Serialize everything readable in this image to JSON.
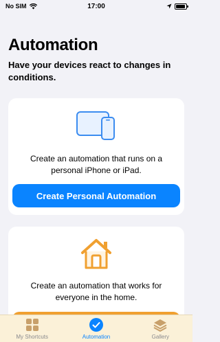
{
  "status": {
    "carrier": "No SIM",
    "time": "17:00"
  },
  "header": {
    "title": "Automation",
    "subtitle": "Have your devices react to changes in conditions."
  },
  "cards": [
    {
      "icon": "iphone-ipad-icon",
      "text": "Create an automation that runs on a personal iPhone or iPad.",
      "button_label": "Create Personal Automation"
    },
    {
      "icon": "home-icon",
      "text": "Create an automation that works for everyone in the home."
    }
  ],
  "tabs": [
    {
      "label": "My Shortcuts",
      "icon": "grid-icon",
      "active": false
    },
    {
      "label": "Automation",
      "icon": "clock-check-icon",
      "active": true
    },
    {
      "label": "Gallery",
      "icon": "stack-icon",
      "active": false
    }
  ],
  "colors": {
    "accent": "#0a84ff",
    "home_orange": "#f0a030",
    "background": "#f2f2f7",
    "tab_bar": "#fbf1d8"
  }
}
